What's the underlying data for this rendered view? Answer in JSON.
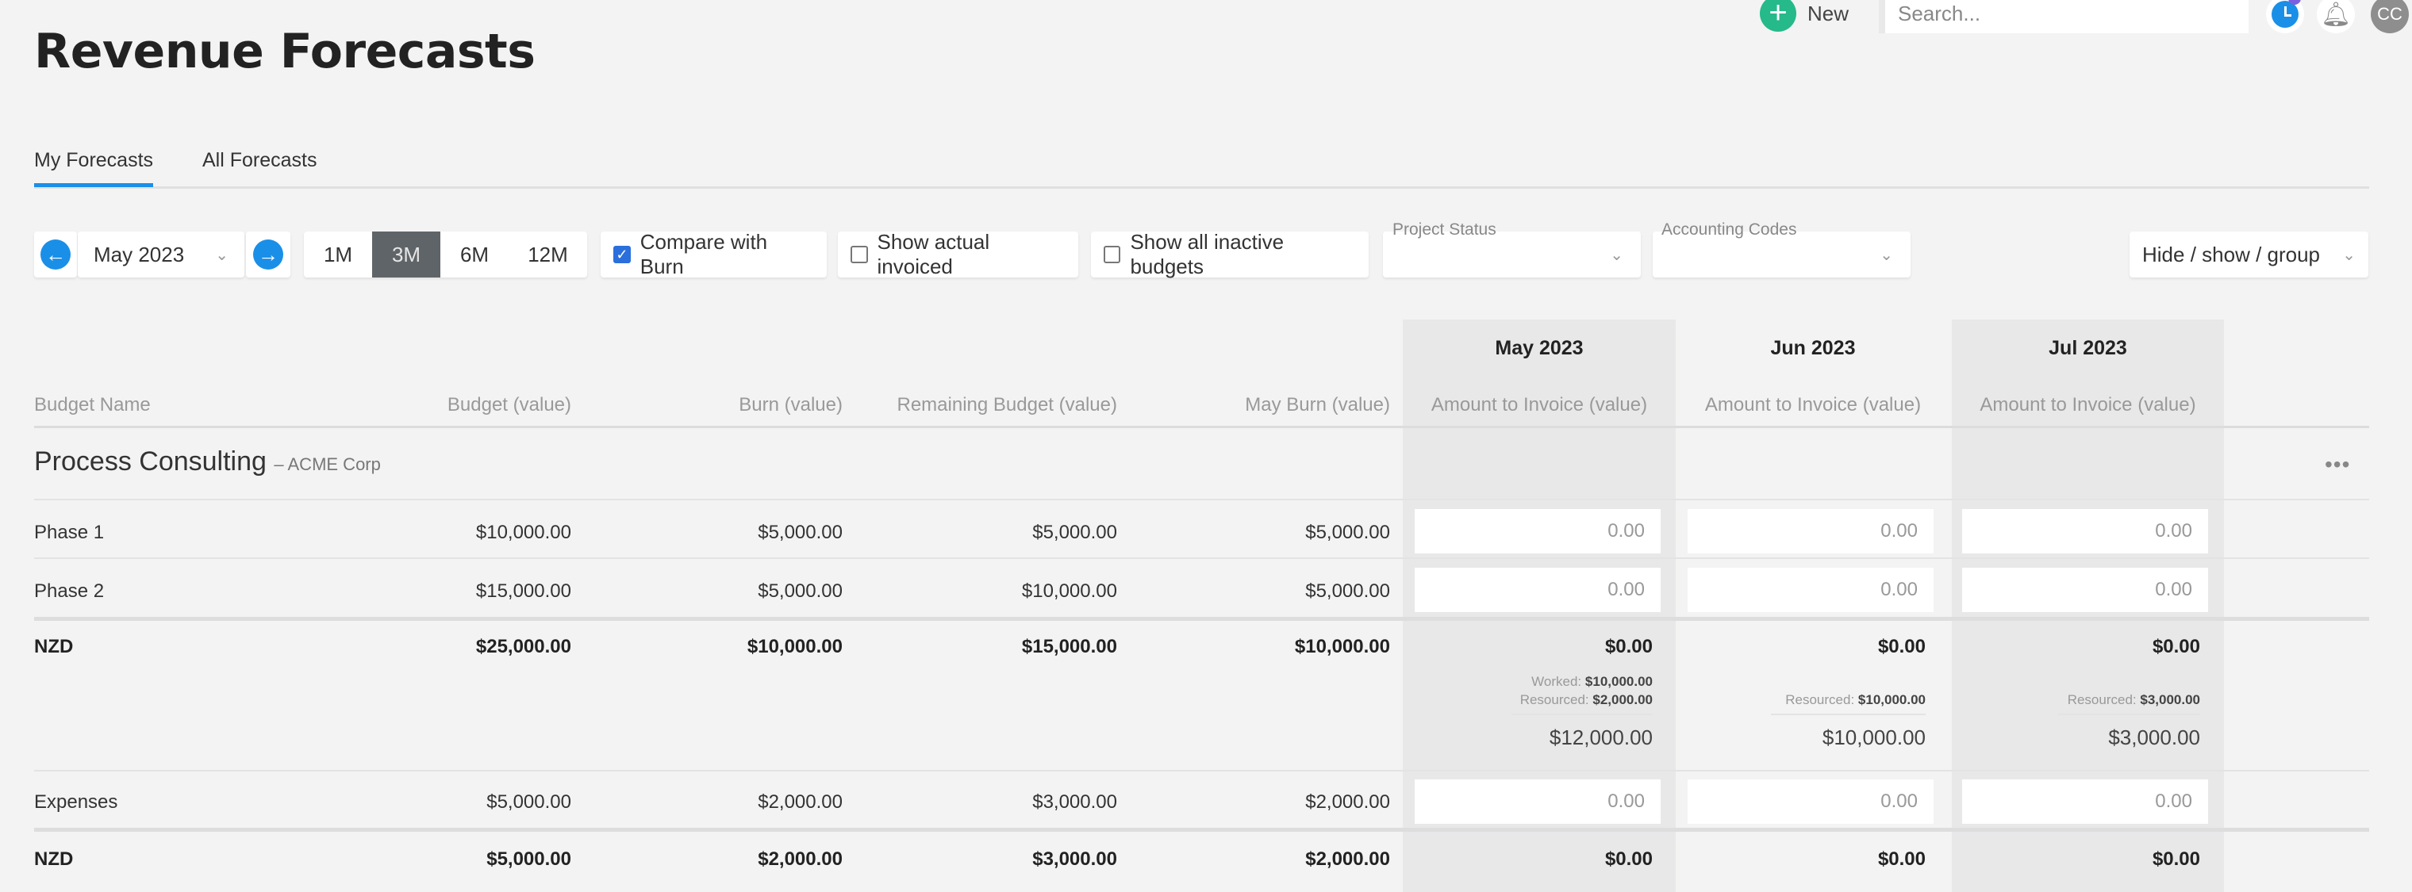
{
  "header": {
    "title": "Revenue Forecasts",
    "new_label": "New",
    "search_placeholder": "Search...",
    "avatar_initials": "CC"
  },
  "tabs": [
    {
      "label": "My Forecasts",
      "active": true
    },
    {
      "label": "All Forecasts",
      "active": false
    }
  ],
  "toolbar": {
    "month": "May 2023",
    "periods": [
      {
        "label": "1M",
        "active": false
      },
      {
        "label": "3M",
        "active": true
      },
      {
        "label": "6M",
        "active": false
      },
      {
        "label": "12M",
        "active": false
      }
    ],
    "compare_with_burn": {
      "label": "Compare with Burn",
      "checked": true
    },
    "show_actual_invoiced": {
      "label": "Show actual invoiced",
      "checked": false
    },
    "show_inactive": {
      "label": "Show all inactive budgets",
      "checked": false
    },
    "project_status": {
      "label": "Project Status",
      "value": ""
    },
    "accounting_codes": {
      "label": "Accounting Codes",
      "value": ""
    },
    "hide_show_group": "Hide / show / group"
  },
  "table": {
    "months": [
      "May 2023",
      "Jun 2023",
      "Jul 2023"
    ],
    "columns": {
      "name": "Budget Name",
      "budget": "Budget (value)",
      "burn": "Burn (value)",
      "remaining": "Remaining Budget (value)",
      "month_burn": "May Burn (value)",
      "amount_to_invoice": "Amount to Invoice (value)"
    },
    "group": {
      "title": "Process Consulting",
      "client": "– ACME Corp",
      "more_icon": "ellipsis-icon"
    },
    "rows": [
      {
        "name": "Phase 1",
        "budget": "$10,000.00",
        "burn": "$5,000.00",
        "remaining": "$5,000.00",
        "month_burn": "$5,000.00",
        "invoice": [
          "0.00",
          "0.00",
          "0.00"
        ]
      },
      {
        "name": "Phase 2",
        "budget": "$15,000.00",
        "burn": "$5,000.00",
        "remaining": "$10,000.00",
        "month_burn": "$5,000.00",
        "invoice": [
          "0.00",
          "0.00",
          "0.00"
        ]
      }
    ],
    "subtotal": {
      "name": "NZD",
      "budget": "$25,000.00",
      "burn": "$10,000.00",
      "remaining": "$15,000.00",
      "month_burn": "$10,000.00",
      "invoice": [
        "$0.00",
        "$0.00",
        "$0.00"
      ],
      "breakdown": [
        {
          "worked_label": "Worked:",
          "worked": "$10,000.00",
          "resourced_label": "Resourced:",
          "resourced": "$2,000.00",
          "total": "$12,000.00"
        },
        {
          "resourced_label": "Resourced:",
          "resourced": "$10,000.00",
          "total": "$10,000.00"
        },
        {
          "resourced_label": "Resourced:",
          "resourced": "$3,000.00",
          "total": "$3,000.00"
        }
      ]
    },
    "expenses": {
      "name": "Expenses",
      "budget": "$5,000.00",
      "burn": "$2,000.00",
      "remaining": "$3,000.00",
      "month_burn": "$2,000.00",
      "invoice": [
        "0.00",
        "0.00",
        "0.00"
      ]
    },
    "expenses_total": {
      "name": "NZD",
      "budget": "$5,000.00",
      "burn": "$2,000.00",
      "remaining": "$3,000.00",
      "month_burn": "$2,000.00",
      "invoice": [
        "$0.00",
        "$0.00",
        "$0.00"
      ]
    }
  },
  "colors": {
    "accent": "#1a8fe8",
    "new_button": "#26b98a",
    "active_period": "#5f6468",
    "checkbox": "#2a6fdb",
    "notification_badge": "#7b5fe0"
  }
}
